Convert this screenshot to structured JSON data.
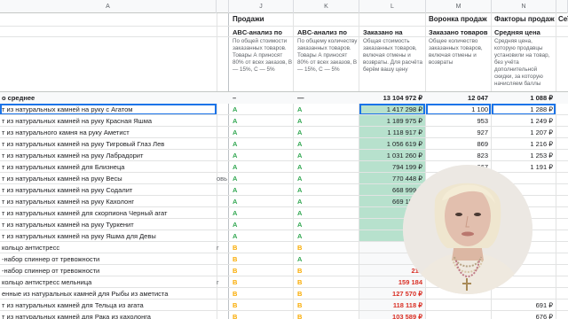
{
  "columns": {
    "a": "A",
    "j": "J",
    "k": "K",
    "l": "L",
    "m": "M",
    "n": "N"
  },
  "groups": {
    "sales": "Продажи",
    "funnel": "Воронка продаж",
    "factors": "Факторы продаж",
    "overflow": "Сеї"
  },
  "headers": {
    "j": "ABC-анализ по",
    "k": "ABC-анализ по",
    "l": "Заказано на",
    "m": "Заказано товаров",
    "n": "Средняя цена"
  },
  "descriptions": {
    "j": "По общей стоимости заказанных товаров. Товары А приносят 80% от всех заказов, B — 15%, C — 5%",
    "k": "По общему количеству заказанных товаров. Товары А приносят 80% от всех заказов, B — 15%, C — 5%",
    "l": "Общая стоимость заказанных товаров, включая отмены и возвраты. Для расчёта берём вашу цену",
    "m": "Общее количество заказанных товаров, включая отмены и возвраты",
    "n": "Средняя цена, которую продавцы установили на товар, без учёта дополнительной скидки, за которую начисляем баллы"
  },
  "summary": {
    "a": "о среднее",
    "j": "–",
    "k": "—",
    "l": "13 104 972 ₽",
    "m": "12 047",
    "n": "1 088 ₽"
  },
  "rows": [
    {
      "a": "т из натуральных камней на руку с Агатом",
      "b": "",
      "j": "A",
      "k": "A",
      "l": "1 417 298 ₽",
      "m": "1 100",
      "n": "1 288 ₽"
    },
    {
      "a": "т из натуральных камней на руку Красная Яшма",
      "b": "",
      "j": "A",
      "k": "A",
      "l": "1 189 975 ₽",
      "m": "953",
      "n": "1 249 ₽"
    },
    {
      "a": "т из натурального камня на руку Аметист",
      "b": "",
      "j": "A",
      "k": "A",
      "l": "1 118 917 ₽",
      "m": "927",
      "n": "1 207 ₽"
    },
    {
      "a": "т из натуральных камней на руку Тигровый Глаз Лев",
      "b": "",
      "j": "A",
      "k": "A",
      "l": "1 056 619 ₽",
      "m": "869",
      "n": "1 216 ₽"
    },
    {
      "a": "т из натуральных камней на руку Лабрадорит",
      "b": "",
      "j": "A",
      "k": "A",
      "l": "1 031 260 ₽",
      "m": "823",
      "n": "1 253 ₽"
    },
    {
      "a": "т из натуральных камней для Близнеца",
      "b": "",
      "j": "A",
      "k": "A",
      "l": "794 199 ₽",
      "m": "667",
      "n": "1 191 ₽"
    },
    {
      "a": "т из натуральных камней на руку Весы",
      "b": "овь",
      "j": "A",
      "k": "A",
      "l": "770 448 ₽",
      "m": "",
      "n": ""
    },
    {
      "a": "т из натуральных камней на руку Содалит",
      "b": "",
      "j": "A",
      "k": "A",
      "l": "668 999 ₽",
      "m": "",
      "n": ""
    },
    {
      "a": "т из натуральных камней на руку Кахолонг",
      "b": "",
      "j": "A",
      "k": "A",
      "l": "669 159 ₽",
      "m": "",
      "n": ""
    },
    {
      "a": "т из натуральных камней для скорпиона Черный агат",
      "b": "",
      "j": "A",
      "k": "A",
      "l": "",
      "m": "",
      "n": ""
    },
    {
      "a": "т из натуральных камней на руку Туркенит",
      "b": "",
      "j": "A",
      "k": "A",
      "l": "",
      "m": "",
      "n": ""
    },
    {
      "a": "т из натуральных камней на руку Яшма для Девы",
      "b": "",
      "j": "A",
      "k": "A",
      "l": "",
      "m": "",
      "n": ""
    },
    {
      "a": "кольцо антистресс",
      "b": "r",
      "j": "B",
      "k": "B",
      "l": "264",
      "m": "",
      "n": ""
    },
    {
      "a": "-набор спиннер от тревожности",
      "b": "",
      "j": "B",
      "k": "A",
      "l": "227",
      "m": "",
      "n": ""
    },
    {
      "a": "-набор спиннер от тревожности",
      "b": "",
      "j": "B",
      "k": "B",
      "l": "218",
      "m": "",
      "n": ""
    },
    {
      "a": "кольцо антистресс мельница",
      "b": "r",
      "j": "B",
      "k": "B",
      "l": "159 184",
      "m": "",
      "n": ""
    },
    {
      "a": "енные из натуральных камней для Рыбы из аметиста",
      "b": "",
      "j": "B",
      "k": "B",
      "l": "127 570 ₽",
      "m": "",
      "n": ""
    },
    {
      "a": "т из натуральных камней для Тельца из агата",
      "b": "",
      "j": "B",
      "k": "B",
      "l": "118 118 ₽",
      "m": "",
      "n": "691 ₽"
    },
    {
      "a": "т из натуральных камней для Рака из кахолонга",
      "b": "",
      "j": "B",
      "k": "B",
      "l": "103 589 ₽",
      "m": "",
      "n": "676 ₽"
    },
    {
      "a": "т из натуральных камней для Овна из красной яшмы",
      "b": "",
      "j": "B",
      "k": "B",
      "l": "96 105 ₽",
      "m": "149",
      "n": "680 ₽"
    }
  ]
}
